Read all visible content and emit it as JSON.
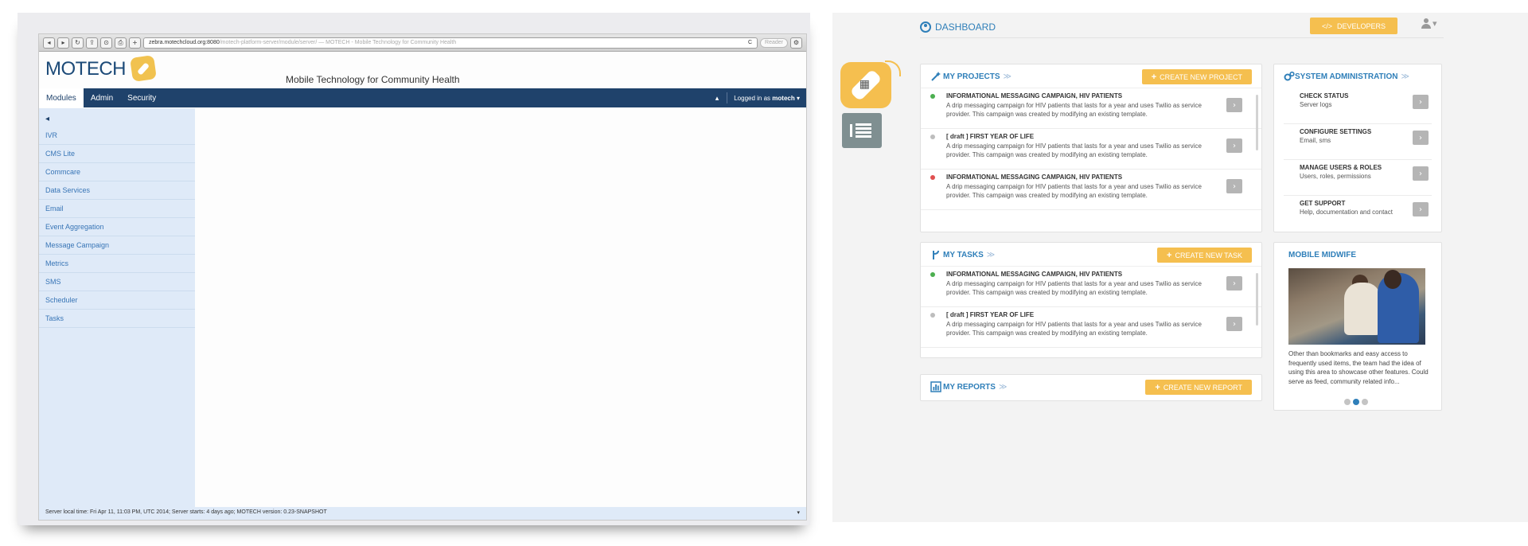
{
  "legacy": {
    "chrome_buttons": [
      "◂",
      "▸",
      "↻",
      "⇪",
      "⊙",
      "⎙",
      "+"
    ],
    "url_host": "zebra.motechcloud.org:8080",
    "url_path": "/motech-platform-server/module/server/ — MOTECH - Mobile Technology for Community Health",
    "reload_icon": "C",
    "reader_label": "Reader",
    "logo_text": "MOTECH",
    "subtitle": "Mobile Technology for Community Health",
    "tabs": [
      "Modules",
      "Admin",
      "Security"
    ],
    "nav_up": "▴",
    "logged_in_prefix": "Logged in as",
    "logged_in_user": "motech",
    "sidebar_toggle": "◂",
    "sidebar_links": [
      "IVR",
      "CMS Lite",
      "Commcare",
      "Data Services",
      "Email",
      "Event Aggregation",
      "Message Campaign",
      "Metrics",
      "SMS",
      "Scheduler",
      "Tasks"
    ],
    "footer_text": "Server local time: Fri Apr 11, 11:03 PM, UTC 2014; Server starts: 4 days ago; MOTECH version: 0.23-SNAPSHOT",
    "footer_arrow": "▾"
  },
  "dashboard": {
    "title": "DASHBOARD",
    "developers_label": "DEVELOPERS",
    "developers_icon": "</>",
    "user_menu_caret": "▾",
    "projects": {
      "title": "MY PROJECTS",
      "chevron": "≫",
      "create_label": "CREATE NEW PROJECT",
      "items": [
        {
          "title": "INFORMATIONAL MESSAGING CAMPAIGN, HIV PATIENTS",
          "desc": "A drip messaging campaign for HIV patients that lasts for a year and uses Twilio as service provider. This campaign was created by modifying an existing template.",
          "status_color": "#4caf50"
        },
        {
          "title": "[ draft ] FIRST YEAR OF LIFE",
          "desc": "A drip messaging campaign for HIV patients that lasts for a year and uses Twilio as service provider. This campaign was created by modifying an existing template.",
          "status_color": "#bdbdbd"
        },
        {
          "title": "INFORMATIONAL MESSAGING CAMPAIGN, HIV PATIENTS",
          "desc": "A drip messaging campaign for HIV patients that lasts for a year and uses Twilio as service provider. This campaign was created by modifying an existing template.",
          "status_color": "#e05050"
        }
      ]
    },
    "tasks": {
      "title": "MY TASKS",
      "chevron": "≫",
      "create_label": "CREATE  NEW TASK",
      "items": [
        {
          "title": "INFORMATIONAL MESSAGING CAMPAIGN, HIV PATIENTS",
          "desc": "A drip messaging campaign for HIV patients that lasts for a year and uses Twilio as service provider. This campaign was created by modifying an existing template.",
          "status_color": "#4caf50"
        },
        {
          "title": "[ draft ] FIRST YEAR OF LIFE",
          "desc": "A drip messaging campaign for HIV patients that lasts for a year and uses Twilio as service provider. This campaign was created by modifying an existing template.",
          "status_color": "#bdbdbd"
        }
      ]
    },
    "reports": {
      "title": "MY REPORTS",
      "chevron": "≫",
      "create_label": "CREATE NEW REPORT"
    },
    "admin": {
      "title": "SYSTEM ADMINISTRATION",
      "chevron": "≫",
      "items": [
        {
          "title": "CHECK STATUS",
          "sub": "Server logs"
        },
        {
          "title": "CONFIGURE SETTINGS",
          "sub": "Email, sms"
        },
        {
          "title": "MANAGE USERS & ROLES",
          "sub": "Users, roles, permissions"
        },
        {
          "title": "GET SUPPORT",
          "sub": "Help, documentation and contact"
        }
      ]
    },
    "midwife": {
      "title": "MOBILE MIDWIFE",
      "text": "Other than bookmarks and easy access to frequently used items, the team had the idea of using this area to showcase other features. Could serve as feed, community related info...",
      "active_slide": 2,
      "slide_count": 3
    },
    "go_glyph": "›",
    "plus_glyph": "+"
  },
  "colors": {
    "legacy_nav": "#1f426b",
    "legacy_sidebar": "#dfeaf8",
    "legacy_link": "#3875b6",
    "accent_blue": "#2f7fb9",
    "button_yellow": "#f5bf4f",
    "button_gray": "#b5b5b5"
  }
}
